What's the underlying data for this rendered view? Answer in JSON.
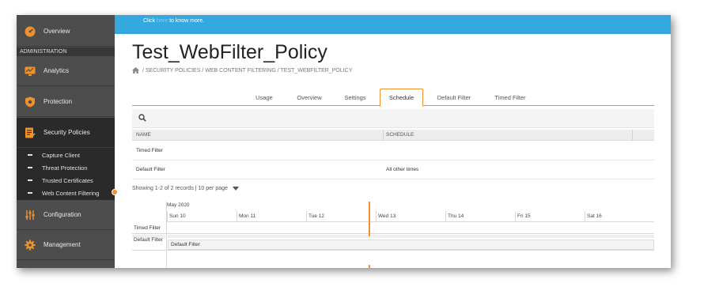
{
  "banner": {
    "prefix": "Click ",
    "link": "here",
    "suffix": " to know more."
  },
  "sidebar": {
    "items": [
      {
        "label": "Overview",
        "icon": "dashboard-icon"
      },
      {
        "label": "Analytics",
        "icon": "monitor-icon"
      },
      {
        "label": "Protection",
        "icon": "shield-icon"
      },
      {
        "label": "Security Policies",
        "icon": "policy-icon"
      },
      {
        "label": "Configuration",
        "icon": "sliders-icon"
      },
      {
        "label": "Management",
        "icon": "gear-icon"
      }
    ],
    "section_header": "ADMINISTRATION",
    "sub_items": [
      "Capture Client",
      "Threat Protection",
      "Trusted Certificates",
      "Web Content Filtering"
    ]
  },
  "page": {
    "title": "Test_WebFilter_Policy",
    "breadcrumb": "/ SECURITY POLICIES / WEB CONTENT FILTERING / TEST_WEBFILTER_POLICY"
  },
  "tabs": [
    "Usage",
    "Overview",
    "Settings",
    "Schedule",
    "Default Filter",
    "Timed Filter"
  ],
  "active_tab": "Schedule",
  "table": {
    "columns": [
      "NAME",
      "SCHEDULE"
    ],
    "rows": [
      {
        "name": "Timed Filter",
        "schedule": ""
      },
      {
        "name": "Default Filter",
        "schedule": "All other times"
      }
    ]
  },
  "pager": {
    "text": "Showing 1-2 of 2 records | 10 per page"
  },
  "calendar": {
    "month": "May 2020",
    "days": [
      "Sun 10",
      "Mon 11",
      "Tue 12",
      "Wed 13",
      "Thu 14",
      "Fri 15",
      "Sat 16"
    ],
    "rows": [
      "Timed Filter",
      "Default Filter"
    ],
    "event": "Default Filter"
  },
  "colors": {
    "accent": "#f0922b",
    "banner": "#35a8e0",
    "sidebar": "#4d4d4d"
  }
}
